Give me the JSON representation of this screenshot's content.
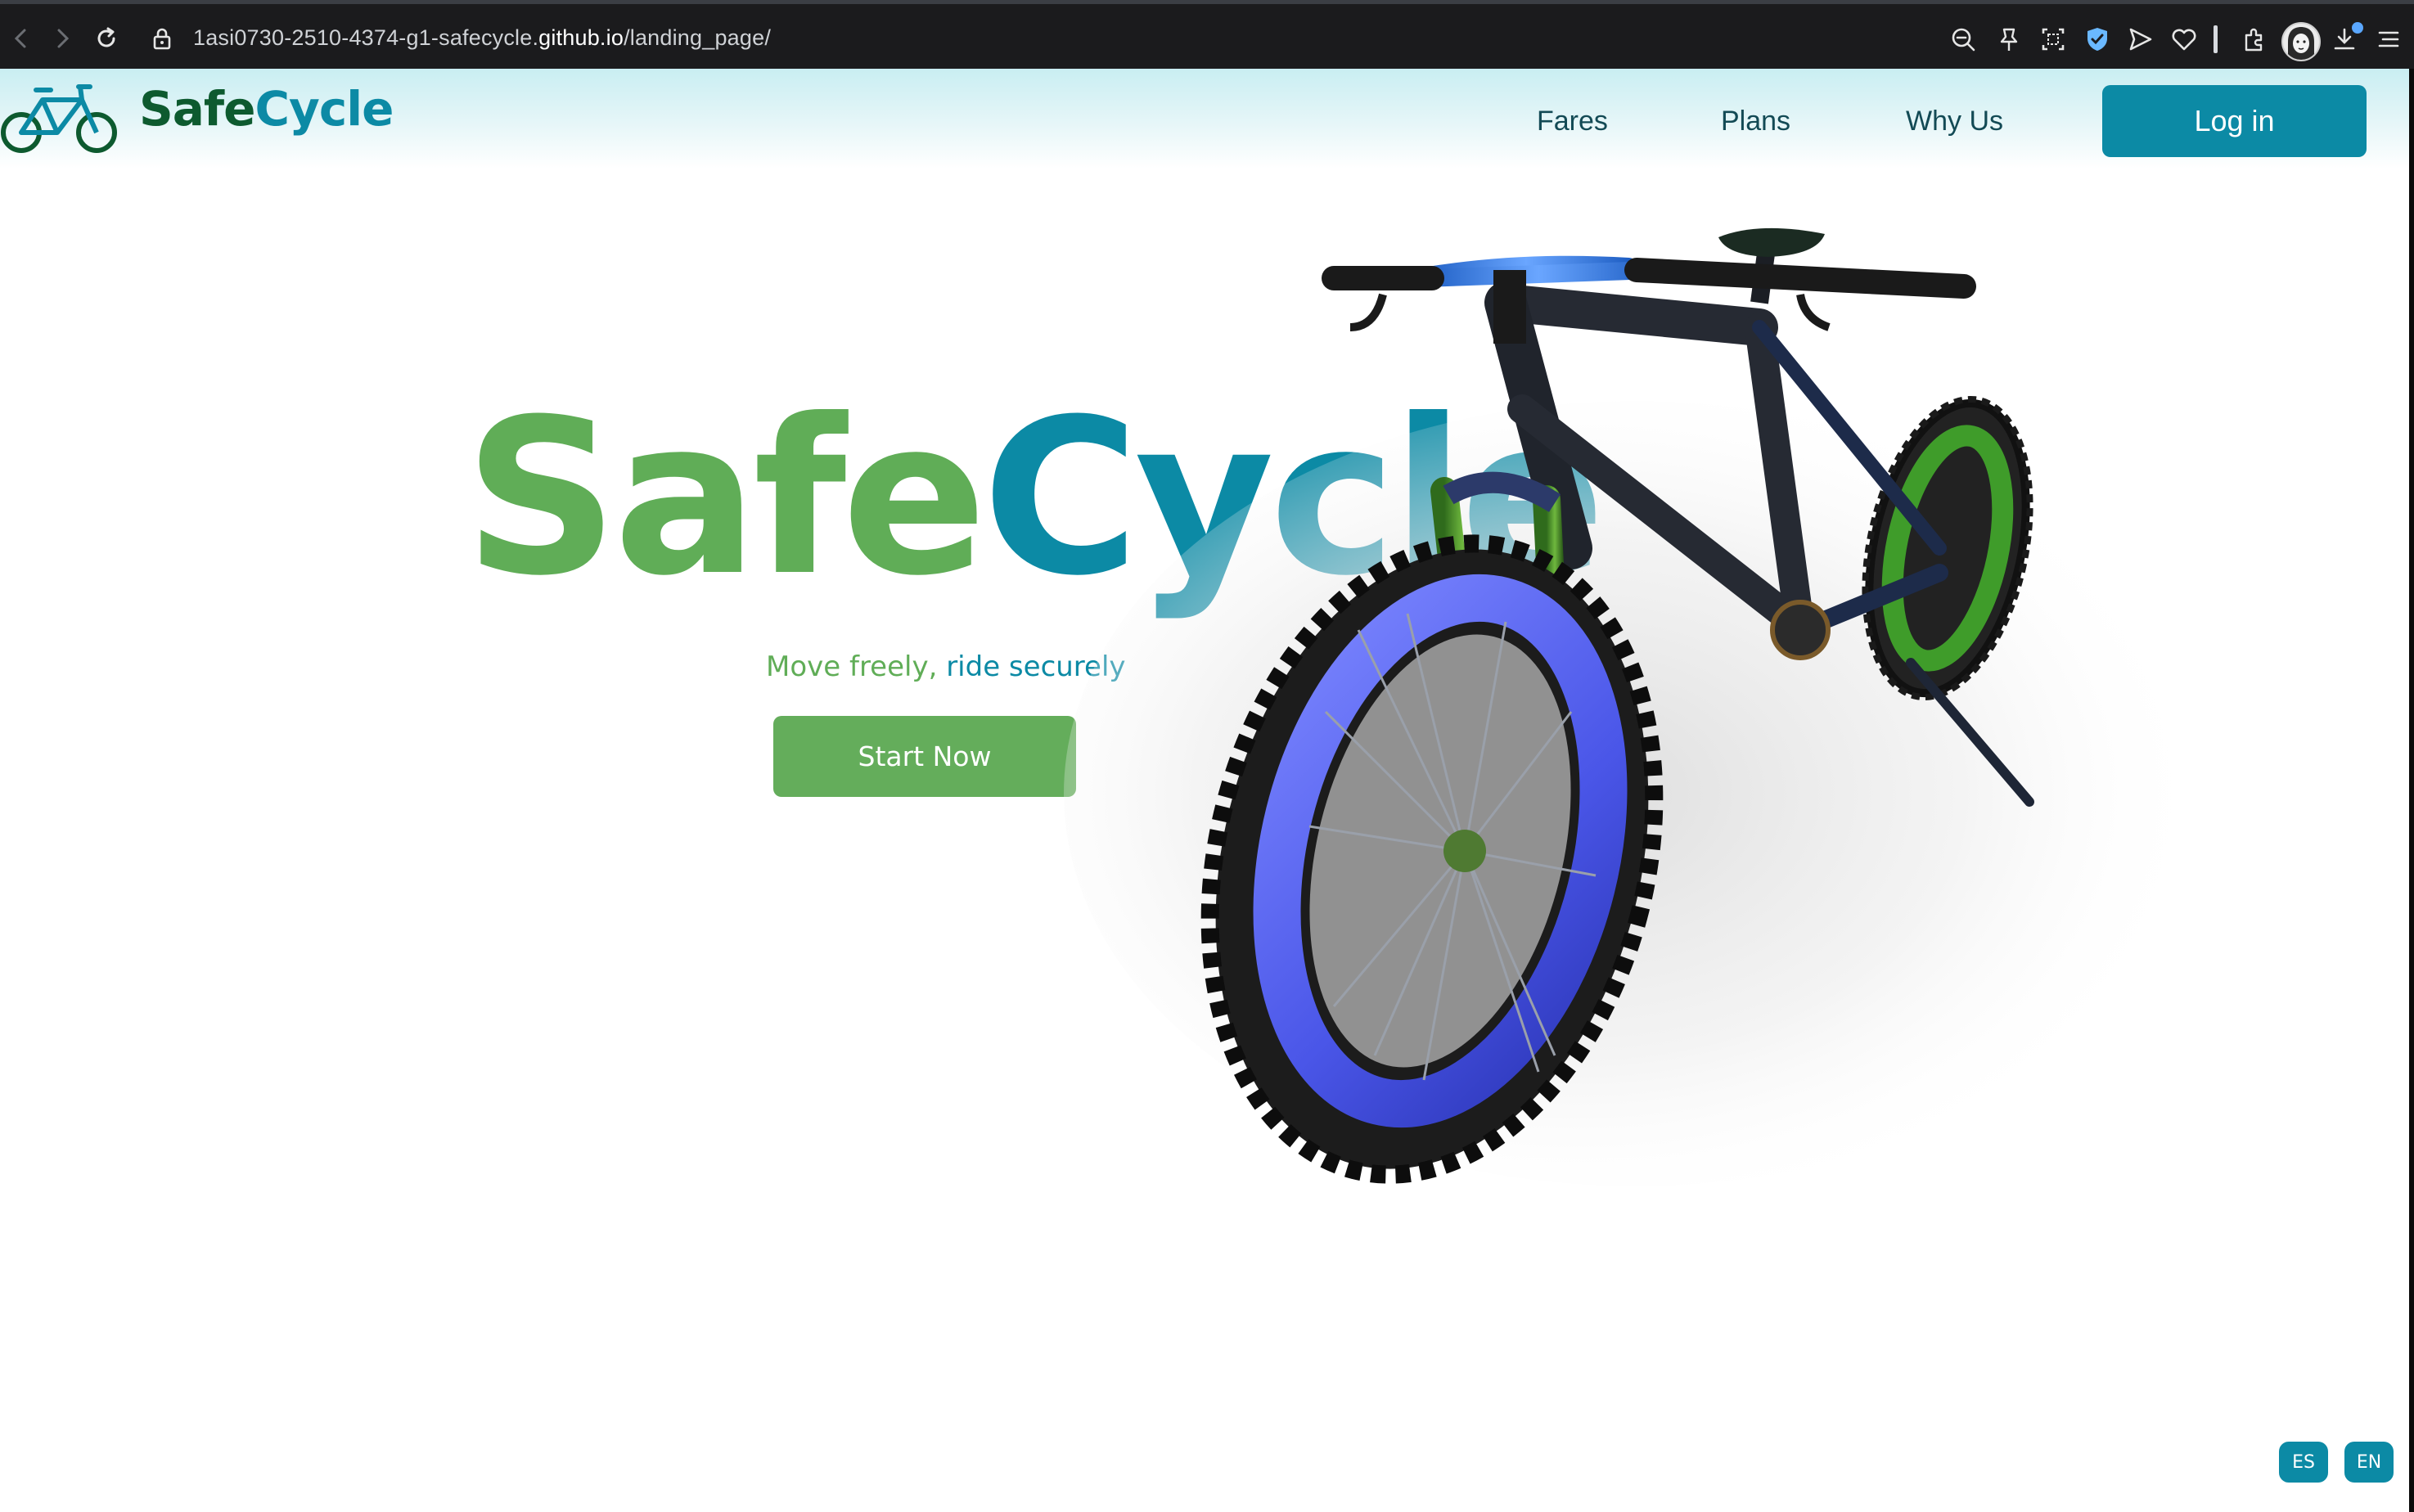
{
  "browser": {
    "url_prefix": "1asi0730-2510-4374-g1-safecycle.",
    "url_host": "github.io",
    "url_path": "/landing_page/",
    "icons": [
      "back-icon",
      "forward-icon",
      "reload-icon",
      "lock-icon",
      "zoom-out-icon",
      "pin-icon",
      "screenshot-icon",
      "shield-icon",
      "send-icon",
      "heart-icon",
      "extensions-icon",
      "download-icon",
      "menu-icon"
    ]
  },
  "header": {
    "logo_safe": "Safe",
    "logo_cycle": "Cycle",
    "nav": [
      {
        "label": "Fares"
      },
      {
        "label": "Plans"
      },
      {
        "label": "Why Us"
      }
    ],
    "login_label": "Log in"
  },
  "hero": {
    "title_safe": "Safe",
    "title_cycle": "Cycle",
    "tagline_a": "Move freely, ",
    "tagline_b": "ride securely",
    "cta_label": "Start Now"
  },
  "languages": [
    {
      "label": "ES"
    },
    {
      "label": "EN"
    }
  ],
  "colors": {
    "brand_green": "#60ad57",
    "brand_teal": "#0c8aa5",
    "dark_green": "#0d5a2f"
  }
}
